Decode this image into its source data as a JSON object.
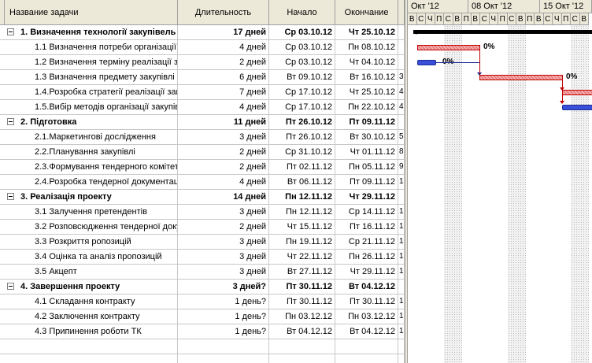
{
  "headers": {
    "name": "Название задачи",
    "duration": "Длительность",
    "start": "Начало",
    "end": "Окончание"
  },
  "timeline": {
    "weeks": [
      "Окт '12",
      "08 Окт '12",
      "15 Окт '12"
    ],
    "days": [
      "В",
      "С",
      "Ч",
      "П",
      "С",
      "В",
      "П",
      "В",
      "С",
      "Ч",
      "П",
      "С",
      "В",
      "П",
      "В",
      "С",
      "Ч",
      "П",
      "С",
      "В"
    ],
    "bar_labels": [
      "0%",
      "0%",
      "0%"
    ]
  },
  "tasks": [
    {
      "name": "1. Визначення технології закупівель",
      "duration": "17 дней",
      "start": "Ср 03.10.12",
      "end": "Чт 25.10.12",
      "pred": "",
      "summary": true
    },
    {
      "name": "1.1 Визначення потреби організації",
      "duration": "4 дней",
      "start": "Ср 03.10.12",
      "end": "Пн 08.10.12",
      "pred": "",
      "summary": false
    },
    {
      "name": "1.2 Визначення терміну реалізації закупівлі",
      "duration": "2 дней",
      "start": "Ср 03.10.12",
      "end": "Чт 04.10.12",
      "pred": "",
      "summary": false
    },
    {
      "name": "1.3 Визначення предмету закупівлі",
      "duration": "6 дней",
      "start": "Вт 09.10.12",
      "end": "Вт 16.10.12",
      "pred": "3",
      "summary": false
    },
    {
      "name": "1.4.Розробка стратегії реалізації закупівлі",
      "duration": "7 дней",
      "start": "Ср 17.10.12",
      "end": "Чт 25.10.12",
      "pred": "4",
      "summary": false
    },
    {
      "name": "1.5.Вибір методів організації закупівлі",
      "duration": "4 дней",
      "start": "Ср 17.10.12",
      "end": "Пн 22.10.12",
      "pred": "4",
      "summary": false
    },
    {
      "name": "2. Підготовка",
      "duration": "11 дней",
      "start": "Пт 26.10.12",
      "end": "Пт 09.11.12",
      "pred": "",
      "summary": true
    },
    {
      "name": "2.1.Маркетингові дослідження",
      "duration": "3 дней",
      "start": "Пт 26.10.12",
      "end": "Вт 30.10.12",
      "pred": "5",
      "summary": false
    },
    {
      "name": "2.2.Планування закупівлі",
      "duration": "2 дней",
      "start": "Ср 31.10.12",
      "end": "Чт 01.11.12",
      "pred": "8",
      "summary": false
    },
    {
      "name": "2.3.Формування тендерного комітету",
      "duration": "2 дней",
      "start": "Пт 02.11.12",
      "end": "Пн 05.11.12",
      "pred": "9",
      "summary": false
    },
    {
      "name": "2.4.Розробка тендерної документації",
      "duration": "4 дней",
      "start": "Вт 06.11.12",
      "end": "Пт 09.11.12",
      "pred": "1",
      "summary": false
    },
    {
      "name": "3. Реалізація проекту",
      "duration": "14 дней",
      "start": "Пн 12.11.12",
      "end": "Чт 29.11.12",
      "pred": "",
      "summary": true
    },
    {
      "name": "3.1 Залучення претендентів",
      "duration": "3 дней",
      "start": "Пн 12.11.12",
      "end": "Ср 14.11.12",
      "pred": "1",
      "summary": false
    },
    {
      "name": "3.2 Розповсюдження тендерної документації",
      "duration": "2 дней",
      "start": "Чт 15.11.12",
      "end": "Пт 16.11.12",
      "pred": "1",
      "summary": false
    },
    {
      "name": "3.3 Розкриття ропозицій",
      "duration": "3 дней",
      "start": "Пн 19.11.12",
      "end": "Ср 21.11.12",
      "pred": "1",
      "summary": false
    },
    {
      "name": "3.4 Оцінка та аналіз пропозицій",
      "duration": "3 дней",
      "start": "Чт 22.11.12",
      "end": "Пн 26.11.12",
      "pred": "1",
      "summary": false
    },
    {
      "name": "3.5 Акцепт",
      "duration": "3 дней",
      "start": "Вт 27.11.12",
      "end": "Чт 29.11.12",
      "pred": "1",
      "summary": false
    },
    {
      "name": "4. Завершення проекту",
      "duration": "3 дней?",
      "start": "Пт 30.11.12",
      "end": "Вт 04.12.12",
      "pred": "",
      "summary": true
    },
    {
      "name": "4.1 Складання контракту",
      "duration": "1 день?",
      "start": "Пт 30.11.12",
      "end": "Пт 30.11.12",
      "pred": "1",
      "summary": false
    },
    {
      "name": "4.2 Заключення контракту",
      "duration": "1 день?",
      "start": "Пн 03.12.12",
      "end": "Пн 03.12.12",
      "pred": "1",
      "summary": false
    },
    {
      "name": "4.3 Припинення роботи ТК",
      "duration": "1 день?",
      "start": "Вт 04.12.12",
      "end": "Вт 04.12.12",
      "pred": "1",
      "summary": false
    }
  ]
}
